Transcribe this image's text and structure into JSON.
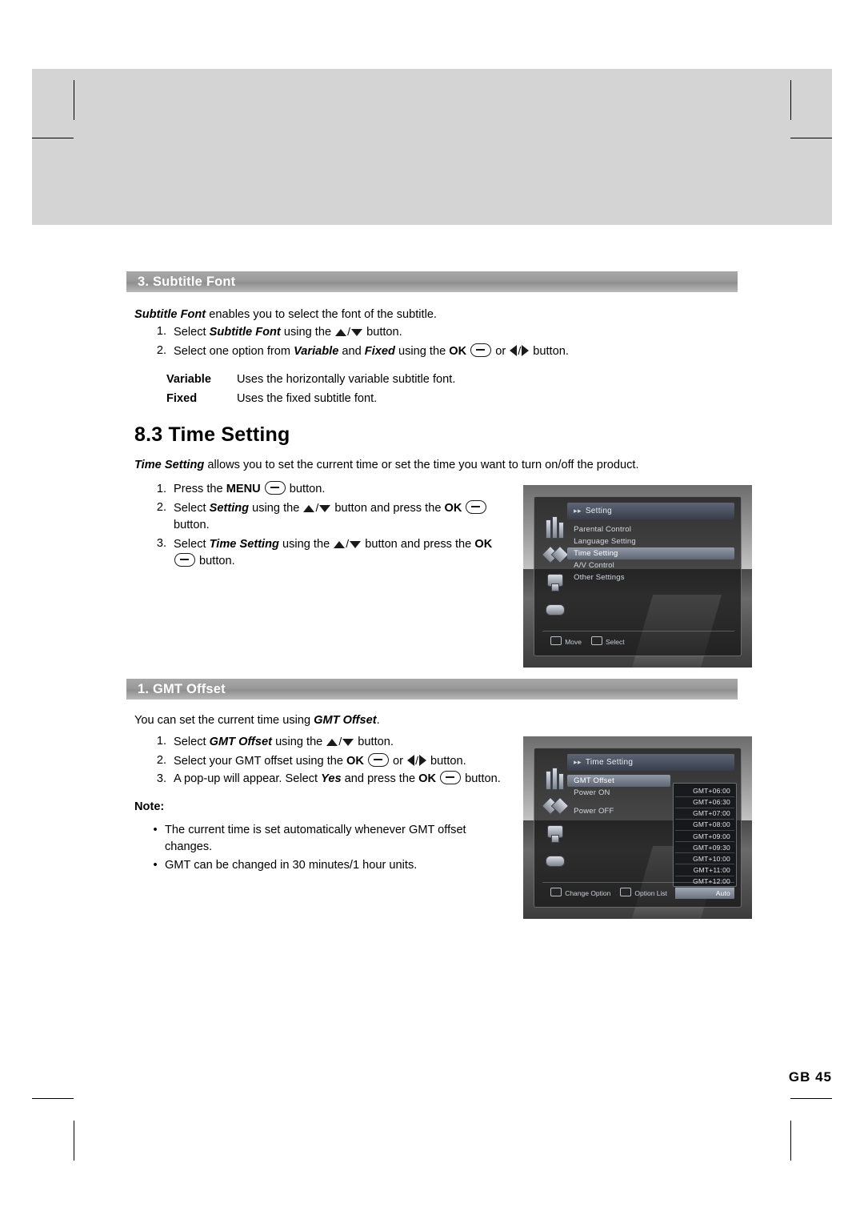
{
  "page": {
    "number_label": "GB  45"
  },
  "sections": {
    "subtitle_font": {
      "bar_label": "3. Subtitle Font",
      "intro_bold": "Subtitle Font",
      "intro_rest": " enables you to select the font of the subtitle.",
      "steps": [
        {
          "num": "1.",
          "pre": "Select ",
          "bold": "Subtitle Font",
          "mid": " using the ",
          "post": " button."
        },
        {
          "num": "2.",
          "pre": "Select one option from ",
          "bold": "Variable",
          "mid": " and ",
          "bold2": "Fixed",
          "mid2": " using the ",
          "ok": "OK",
          "post": " button."
        }
      ],
      "definitions": [
        {
          "term": "Variable",
          "desc": "Uses the horizontally variable subtitle font."
        },
        {
          "term": "Fixed",
          "desc": "Uses the fixed subtitle font."
        }
      ]
    },
    "time_setting": {
      "title": "8.3 Time Setting",
      "intro_bold": "Time Setting",
      "intro_rest": " allows you to set the current time or set the time you want to turn on/off the product.",
      "steps": [
        {
          "num": "1.",
          "pre": "Press the ",
          "bold": "MENU",
          "post": " button."
        },
        {
          "num": "2.",
          "pre": "Select ",
          "bold": "Setting",
          "mid": " using the ",
          "mid2": " button and press the ",
          "ok": "OK",
          "post": " button."
        },
        {
          "num": "3.",
          "pre": "Select ",
          "bold": "Time Setting",
          "mid": " using the ",
          "mid2": " button and press the ",
          "ok": "OK",
          "post": " button."
        }
      ]
    },
    "gmt_offset": {
      "bar_label": "1. GMT Offset",
      "intro_pre": "You can set the current time using ",
      "intro_bold": "GMT Offset",
      "intro_post": ".",
      "steps": [
        {
          "num": "1.",
          "pre": "Select ",
          "bold": "GMT Offset",
          "mid": " using the ",
          "post": " button."
        },
        {
          "num": "2.",
          "pre": "Select your GMT offset using the ",
          "ok": "OK",
          "post": " button."
        },
        {
          "num": "3.",
          "pre": "A pop-up will appear. Select ",
          "bold": "Yes",
          "mid": " and press the ",
          "ok": "OK",
          "post": " button."
        }
      ],
      "note_label": "Note:",
      "notes": [
        "The current time is set automatically whenever GMT offset changes.",
        "GMT can be changed in 30 minutes/1 hour units."
      ]
    }
  },
  "screenshots": {
    "setting_menu": {
      "title": "Setting",
      "items": [
        {
          "label": "Parental Control",
          "selected": false
        },
        {
          "label": "Language Setting",
          "selected": false
        },
        {
          "label": "Time Setting",
          "selected": true
        },
        {
          "label": "A/V Control",
          "selected": false
        },
        {
          "label": "Other Settings",
          "selected": false
        }
      ],
      "footer": [
        {
          "key": "arrows",
          "label": "Move"
        },
        {
          "key": "ok",
          "label": "Select"
        }
      ]
    },
    "time_setting_menu": {
      "title": "Time Setting",
      "items": [
        {
          "label": "GMT Offset",
          "selected": true,
          "value": "GMT+06:00"
        },
        {
          "label": "Power ON",
          "selected": false
        },
        {
          "label": "Power OFF",
          "selected": false
        }
      ],
      "options": [
        "GMT+06:00",
        "GMT+06:30",
        "GMT+07:00",
        "GMT+08:00",
        "GMT+09:00",
        "GMT+09:30",
        "GMT+10:00",
        "GMT+11:00",
        "GMT+12:00",
        "Auto"
      ],
      "footer": [
        {
          "key": "arrows",
          "label": "Change Option"
        },
        {
          "key": "ok",
          "label": "Option List"
        }
      ]
    }
  }
}
